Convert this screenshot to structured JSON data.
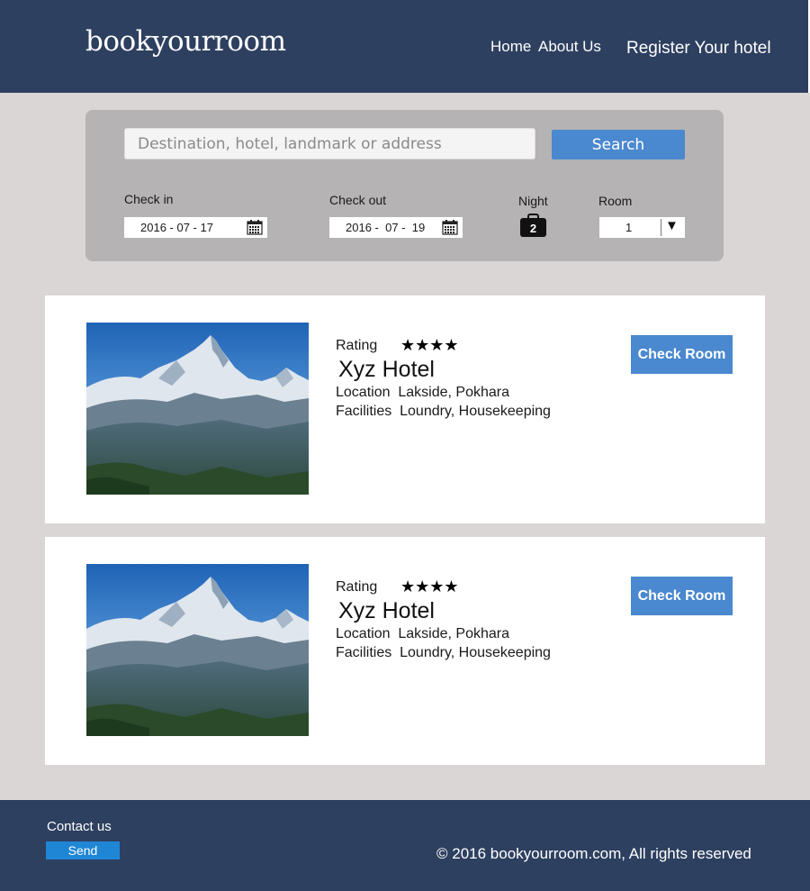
{
  "header": {
    "logo": "bookyourroom",
    "nav": {
      "home": "Home",
      "about": "About Us",
      "register": "Register Your hotel"
    }
  },
  "search": {
    "placeholder": "Destination, hotel, landmark or address",
    "button": "Search",
    "check_in_label": "Check in",
    "check_in_value": "2016 - 07 - 17",
    "check_out_label": "Check out",
    "check_out_value": "2016 -  07 -  19",
    "night_label": "Night",
    "night_value": "2",
    "room_label": "Room",
    "room_value": "1",
    "room_arrow": "▼"
  },
  "hotels": [
    {
      "rating_label": "Rating",
      "stars": "★★★★",
      "star_count": 4,
      "name": "Xyz Hotel",
      "location": "Location  Lakside, Pokhara",
      "facilities": "Facilities  Loundry, Housekeeping",
      "button": "Check Room"
    },
    {
      "rating_label": "Rating",
      "stars": "★★★★",
      "star_count": 4,
      "name": "Xyz Hotel",
      "location": "Location  Lakside, Pokhara",
      "facilities": "Facilities  Loundry, Housekeeping",
      "button": "Check Room"
    }
  ],
  "footer": {
    "contact": "Contact us",
    "send": "Send",
    "copyright": "© 2016 bookyourroom.com, All rights reserved"
  },
  "colors": {
    "header_bg": "#2e4060",
    "page_bg": "#dbd6d6",
    "panel_bg": "#b5b3b3",
    "accent": "#4a88cf"
  }
}
